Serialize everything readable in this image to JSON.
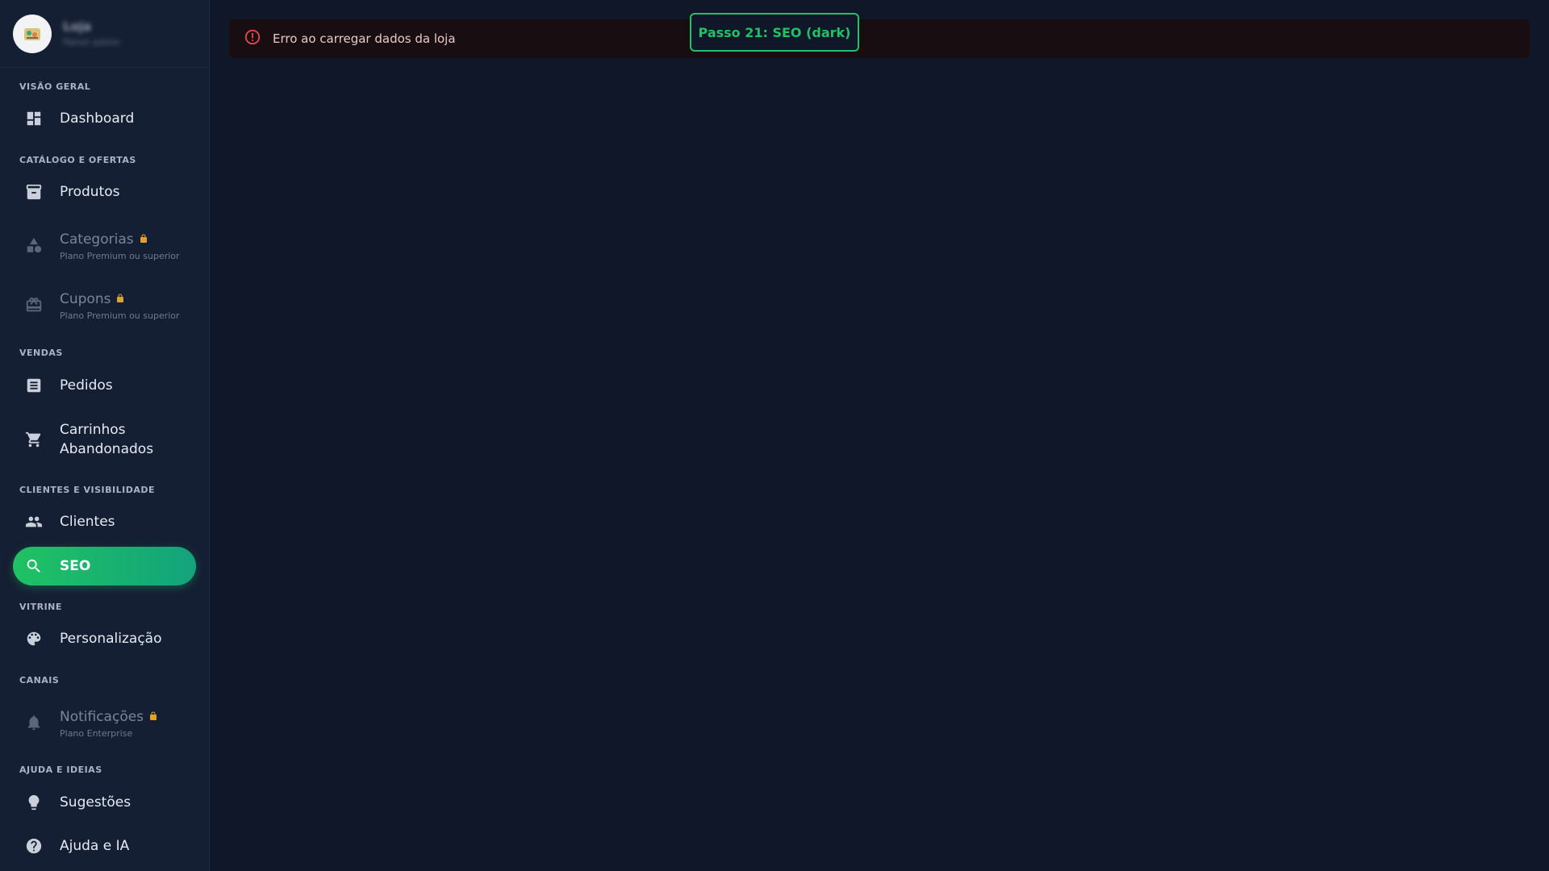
{
  "store": {
    "name": "Loja",
    "subtitle": "Painel admin"
  },
  "sidebar": {
    "sections": {
      "overview": "VISÃO GERAL",
      "catalog": "CATÁLOGO E OFERTAS",
      "sales": "VENDAS",
      "clients": "CLIENTES E VISIBILIDADE",
      "storefront": "VITRINE",
      "channels": "CANAIS",
      "help": "AJUDA E IDEIAS"
    },
    "items": {
      "dashboard": "Dashboard",
      "produtos": "Produtos",
      "categorias": "Categorias",
      "categorias_sub": "Plano Premium ou superior",
      "cupons": "Cupons",
      "cupons_sub": "Plano Premium ou superior",
      "pedidos": "Pedidos",
      "carrinhos_line1": "Carrinhos",
      "carrinhos_line2": "Abandonados",
      "clientes": "Clientes",
      "seo": "SEO",
      "personalizacao": "Personalização",
      "notificacoes": "Notificações",
      "notificacoes_sub": "Plano Enterprise",
      "sugestoes": "Sugestões",
      "ajuda": "Ajuda e IA"
    }
  },
  "main": {
    "error_message": "Erro ao carregar dados da loja",
    "step_badge": "Passo 21: SEO (dark)"
  },
  "colors": {
    "accent": "#20c263",
    "error": "#e5484d",
    "lock": "#e0a22a",
    "background": "#0f1729",
    "sidebar": "#151f33"
  }
}
